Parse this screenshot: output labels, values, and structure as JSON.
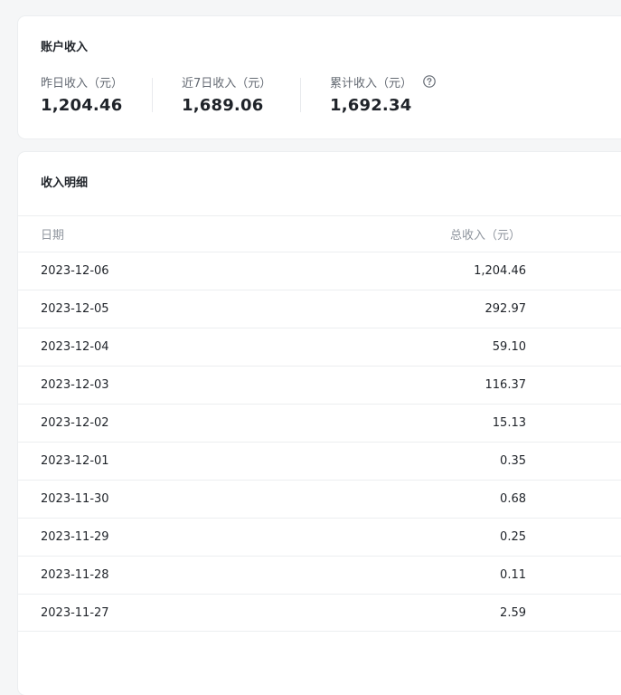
{
  "income_card": {
    "title": "账户收入",
    "stats": [
      {
        "label": "昨日收入（元）",
        "value": "1,204.46"
      },
      {
        "label": "近7日收入（元）",
        "value": "1,689.06"
      },
      {
        "label": "累计收入（元）",
        "value": "1,692.34",
        "icon": "help-circle-icon"
      }
    ]
  },
  "detail_card": {
    "title": "收入明细",
    "columns": {
      "date": "日期",
      "amount": "总收入（元）"
    },
    "rows": [
      {
        "date": "2023-12-06",
        "amount": "1,204.46"
      },
      {
        "date": "2023-12-05",
        "amount": "292.97"
      },
      {
        "date": "2023-12-04",
        "amount": "59.10"
      },
      {
        "date": "2023-12-03",
        "amount": "116.37"
      },
      {
        "date": "2023-12-02",
        "amount": "15.13"
      },
      {
        "date": "2023-12-01",
        "amount": "0.35"
      },
      {
        "date": "2023-11-30",
        "amount": "0.68"
      },
      {
        "date": "2023-11-29",
        "amount": "0.25"
      },
      {
        "date": "2023-11-28",
        "amount": "0.11"
      },
      {
        "date": "2023-11-27",
        "amount": "2.59"
      }
    ]
  },
  "colors": {
    "background": "#f5f6f7",
    "card": "#ffffff",
    "text_primary": "#1f2329",
    "text_secondary": "#646a73",
    "text_muted": "#8f959e",
    "border": "#eceef0"
  }
}
